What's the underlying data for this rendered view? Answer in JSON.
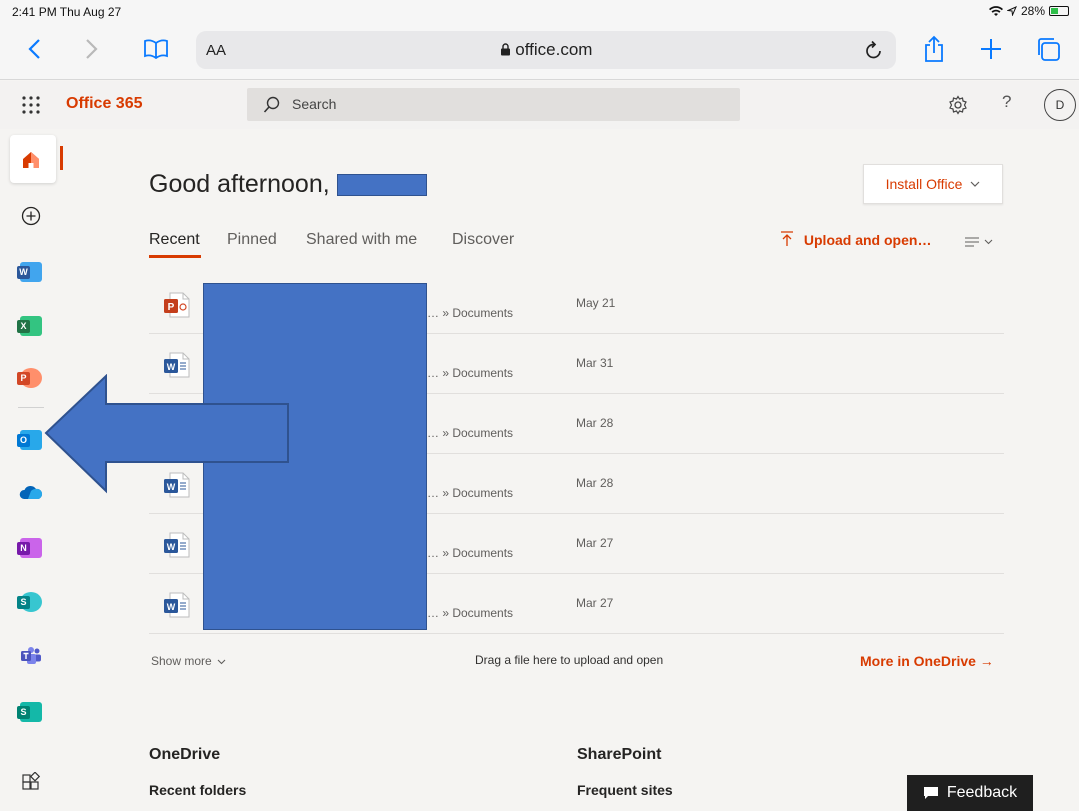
{
  "status": {
    "time": "2:41 PM  Thu Aug 27",
    "battery": "28%"
  },
  "safari": {
    "text_size": "AA",
    "url": "office.com"
  },
  "header": {
    "brand": "Office 365",
    "search_placeholder": "Search",
    "avatar_initial": "D"
  },
  "rail": {
    "apps": [
      {
        "name": "home",
        "icon": "home-icon"
      },
      {
        "name": "create",
        "icon": "plus-circle-icon"
      },
      {
        "name": "word",
        "icon": "word-icon",
        "letter": "W",
        "color": "#2b579a"
      },
      {
        "name": "excel",
        "icon": "excel-icon",
        "letter": "X",
        "color": "#217346"
      },
      {
        "name": "powerpoint",
        "icon": "powerpoint-icon",
        "letter": "P",
        "color": "#d24726"
      },
      {
        "name": "outlook",
        "icon": "outlook-icon",
        "letter": "O",
        "color": "#0078d4"
      },
      {
        "name": "onedrive",
        "icon": "onedrive-icon",
        "color": "#0364b8"
      },
      {
        "name": "onenote",
        "icon": "onenote-icon",
        "letter": "N",
        "color": "#7719aa"
      },
      {
        "name": "sharepoint",
        "icon": "sharepoint-icon",
        "letter": "S",
        "color": "#038387"
      },
      {
        "name": "teams",
        "icon": "teams-icon",
        "color": "#5059c9"
      },
      {
        "name": "sway",
        "icon": "sway-icon",
        "letter": "S",
        "color": "#008272"
      },
      {
        "name": "all-apps",
        "icon": "all-apps-icon"
      }
    ]
  },
  "main": {
    "greeting": "Good afternoon,",
    "install_label": "Install Office",
    "tabs": [
      {
        "label": "Recent"
      },
      {
        "label": "Pinned"
      },
      {
        "label": "Shared with me"
      },
      {
        "label": "Discover"
      }
    ],
    "upload_label": "Upload and open…",
    "files": [
      {
        "type": "powerpoint",
        "path": "… » Documents",
        "date": "May 21"
      },
      {
        "type": "word",
        "path": "… » Documents",
        "date": "Mar 31"
      },
      {
        "type": "word",
        "path": "… » Documents",
        "date": "Mar 28"
      },
      {
        "type": "word",
        "path": "… » Documents",
        "date": "Mar 28"
      },
      {
        "type": "word",
        "path": "… » Documents",
        "date": "Mar 27"
      },
      {
        "type": "word",
        "path": "… » Documents",
        "date": "Mar 27"
      }
    ],
    "show_more": "Show more",
    "drag_hint": "Drag a file here to upload and open",
    "more_onedrive": "More in OneDrive →",
    "onedrive_title": "OneDrive",
    "onedrive_sub": "Recent folders",
    "sharepoint_title": "SharePoint",
    "sharepoint_sub": "Frequent sites",
    "feedback_label": "Feedback"
  },
  "colors": {
    "accent": "#d83b01",
    "mask": "#4472c4"
  }
}
